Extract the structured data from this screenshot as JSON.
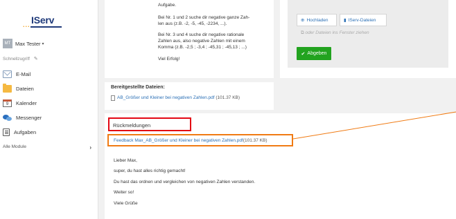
{
  "sidebar": {
    "logo_text": "IServ",
    "user": {
      "initials": "MT",
      "name": "Max Tester"
    },
    "quick_access": "Schnellzugriff",
    "nav": [
      {
        "label": "E-Mail",
        "icon": "mail-icon"
      },
      {
        "label": "Dateien",
        "icon": "folder-icon"
      },
      {
        "label": "Kalender",
        "icon": "calendar-icon"
      },
      {
        "label": "Messenger",
        "icon": "messenger-icon"
      },
      {
        "label": "Aufgaben",
        "icon": "tasks-icon"
      }
    ],
    "calendar_day": "9",
    "all_modules": "Alle Module"
  },
  "task": {
    "lines": [
      "Aufgabe.",
      "Bei Nr. 1 und 2 suche dir negative ganze Zah-",
      "len aus (z.B. -2, -5, -45, -2234, ...).",
      "Bei Nr. 3 und 4 suche dir negative rationale",
      "Zahlen aus, also negative Zahlen mit einem",
      "Komma (z.B. -2,5 ; -3,4 ; -45,31 ; -45,13 ; ...)",
      "Viel Erfolg!"
    ]
  },
  "upload": {
    "upload_label": "Hochladen",
    "iserv_files_label": "IServ-Dateien",
    "drag_hint": "oder Dateien ins Fenster ziehen",
    "submit_label": "Abgeben",
    "accent_color": "#22a31f"
  },
  "files": {
    "title": "Bereitgestellte Dateien:",
    "file_name": "AB_Größer und Kleiner bei negativen Zahlen.pdf",
    "file_size": "(101.37 KB)"
  },
  "feedback": {
    "title": "Rückmeldungen",
    "file_name": "Feedback Max_AB_Größer und Kleiner bei negativen Zahlen.pdf",
    "file_size": "(101.37 KB)",
    "message": [
      "Lieber Max,",
      "super, du hast alles richtig gemacht!",
      "Du hast das ordnen und vergleichen von negativen Zahlen verstanden.",
      "Weiter so!",
      "Viele Grüße"
    ]
  }
}
